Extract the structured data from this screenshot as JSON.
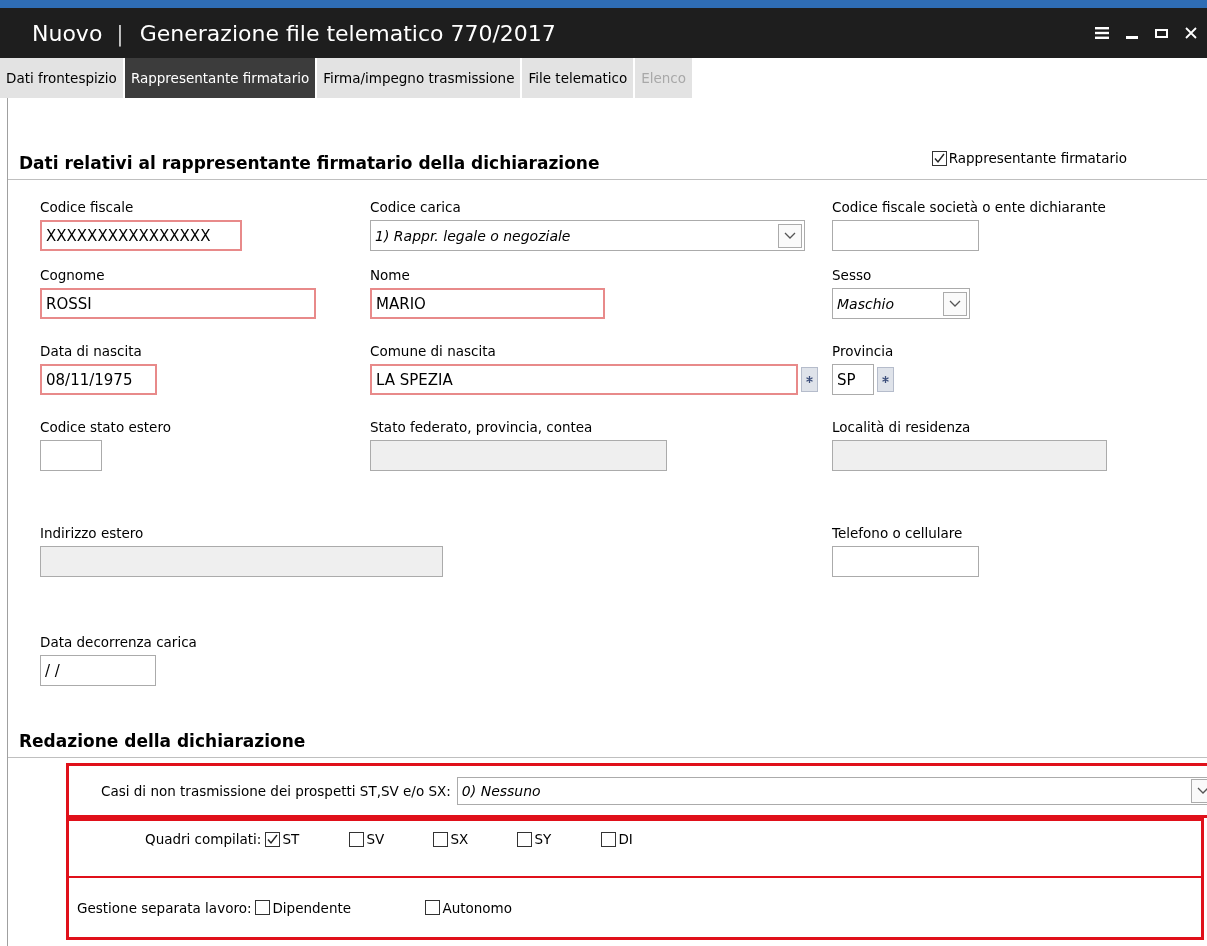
{
  "window": {
    "title_prefix": "Nuovo",
    "separator": "|",
    "title": "Generazione file telematico 770/2017"
  },
  "tabs": [
    {
      "label": "Dati frontespizio",
      "selected": false,
      "disabled": false
    },
    {
      "label": "Rappresentante firmatario",
      "selected": true,
      "disabled": false
    },
    {
      "label": "Firma/impegno trasmissione",
      "selected": false,
      "disabled": false
    },
    {
      "label": "File telematico",
      "selected": false,
      "disabled": false
    },
    {
      "label": "Elenco",
      "selected": false,
      "disabled": true
    }
  ],
  "section1": {
    "title": "Dati relativi al rappresentante firmatario della dichiarazione",
    "checkbox": {
      "label": "Rappresentante firmatario",
      "checked": true
    }
  },
  "rows": [
    {
      "fields": [
        {
          "label": "Codice fiscale",
          "kind": "text",
          "value": "XXXXXXXXXXXXXXXX",
          "required": true,
          "disabled": false
        },
        {
          "label": "Codice carica",
          "kind": "select",
          "value": "1) Rappr. legale o negoziale",
          "required": false,
          "disabled": false
        },
        {
          "label": "Codice fiscale società o ente dichiarante",
          "kind": "text",
          "required": false,
          "disabled": false
        }
      ]
    },
    {
      "fields": [
        {
          "label": "Cognome",
          "kind": "text",
          "value": "ROSSI",
          "required": true,
          "disabled": false
        },
        {
          "label": "Nome",
          "kind": "text",
          "value": "MARIO",
          "required": true,
          "disabled": false
        },
        {
          "label": "Sesso",
          "kind": "select",
          "value": "Maschio",
          "required": false,
          "disabled": false
        }
      ]
    },
    {
      "fields": [
        {
          "label": "Data di nascita",
          "kind": "text",
          "value": "08/11/1975",
          "required": true,
          "disabled": false
        },
        {
          "label": "Comune di nascita",
          "kind": "lookup",
          "value": "LA SPEZIA",
          "required": true,
          "disabled": false
        },
        {
          "label": "Provincia",
          "kind": "lookup",
          "value": "SP",
          "required": false,
          "disabled": false
        }
      ]
    },
    {
      "fields": [
        {
          "label": "Codice stato estero",
          "kind": "text",
          "required": false,
          "disabled": false
        },
        {
          "label": "Stato federato, provincia, contea",
          "kind": "text",
          "required": false,
          "disabled": true
        },
        {
          "label": "Località di residenza",
          "kind": "text",
          "required": false,
          "disabled": true
        }
      ]
    },
    {
      "fields": [
        {
          "label": "Indirizzo estero",
          "kind": "text",
          "required": false,
          "disabled": true
        },
        {
          "label": "Telefono o cellulare",
          "kind": "text",
          "required": false,
          "disabled": false
        }
      ]
    },
    {
      "fields": [
        {
          "label": "Data decorrenza carica",
          "kind": "text",
          "value": "/ /",
          "required": false,
          "disabled": false
        }
      ]
    }
  ],
  "section2": {
    "title": "Redazione della dichiarazione",
    "non_transmission": {
      "label": "Casi di non trasmissione dei prospetti ST,SV e/o SX:",
      "value": "0) Nessuno"
    },
    "quadri": {
      "label": "Quadri compilati:",
      "options": [
        {
          "label": "ST",
          "checked": true
        },
        {
          "label": "SV",
          "checked": false
        },
        {
          "label": "SX",
          "checked": false
        },
        {
          "label": "SY",
          "checked": false
        },
        {
          "label": "DI",
          "checked": false
        }
      ]
    },
    "gestione": {
      "label": "Gestione separata lavoro:",
      "options": [
        {
          "label": "Dipendente",
          "checked": false
        },
        {
          "label": "Autonomo",
          "checked": false
        }
      ]
    }
  }
}
